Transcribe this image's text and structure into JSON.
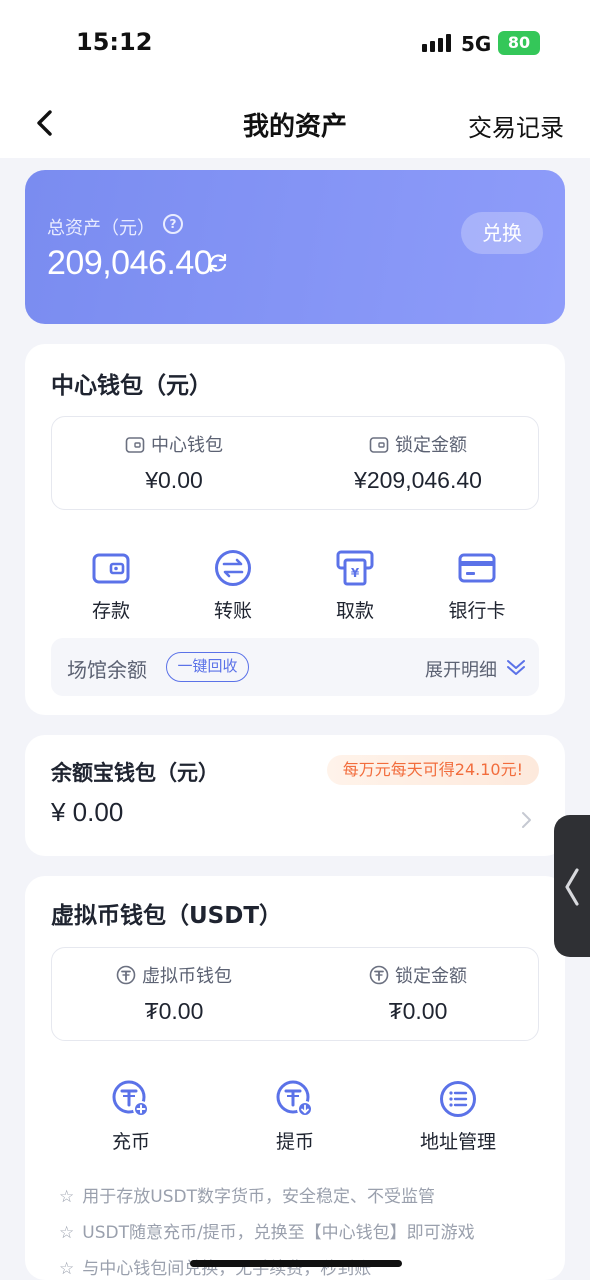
{
  "status_bar": {
    "time": "15:12",
    "network": "5G",
    "battery": "80"
  },
  "nav": {
    "title": "我的资产",
    "right_link": "交易记录"
  },
  "asset_card": {
    "label": "总资产（元）",
    "value": "209,046.40",
    "exchange_button": "兑换"
  },
  "center_wallet": {
    "title": "中心钱包（元）",
    "columns": [
      {
        "label": "中心钱包",
        "value": "¥0.00"
      },
      {
        "label": "锁定金额",
        "value": "¥209,046.40"
      }
    ],
    "actions": [
      {
        "label": "存款",
        "icon": "wallet-icon"
      },
      {
        "label": "转账",
        "icon": "transfer-icon"
      },
      {
        "label": "取款",
        "icon": "withdraw-icon"
      },
      {
        "label": "银行卡",
        "icon": "bank-card-icon"
      }
    ],
    "venue": {
      "label": "场馆余额",
      "recycle_button": "一键回收",
      "expand_label": "展开明细"
    }
  },
  "yuebao_wallet": {
    "title": "余额宝钱包（元）",
    "promo": "每万元每天可得24.10元!",
    "value": "¥ 0.00"
  },
  "crypto_wallet": {
    "title": "虚拟币钱包（USDT）",
    "columns": [
      {
        "label": "虚拟币钱包",
        "value": "₮0.00"
      },
      {
        "label": "锁定金额",
        "value": "₮0.00"
      }
    ],
    "actions": [
      {
        "label": "充币",
        "icon": "deposit-coin-icon"
      },
      {
        "label": "提币",
        "icon": "withdraw-coin-icon"
      },
      {
        "label": "地址管理",
        "icon": "address-list-icon"
      }
    ],
    "notes": [
      "用于存放USDT数字货币，安全稳定、不受监管",
      "USDT随意充币/提币，兑换至【中心钱包】即可游戏",
      "与中心钱包间兑换，无手续费，秒到账"
    ]
  },
  "colors": {
    "accent": "#5b72e8",
    "card_gradient_start": "#7a8cf0",
    "card_gradient_end": "#8e9cfa",
    "promo_text": "#f26d3d"
  }
}
